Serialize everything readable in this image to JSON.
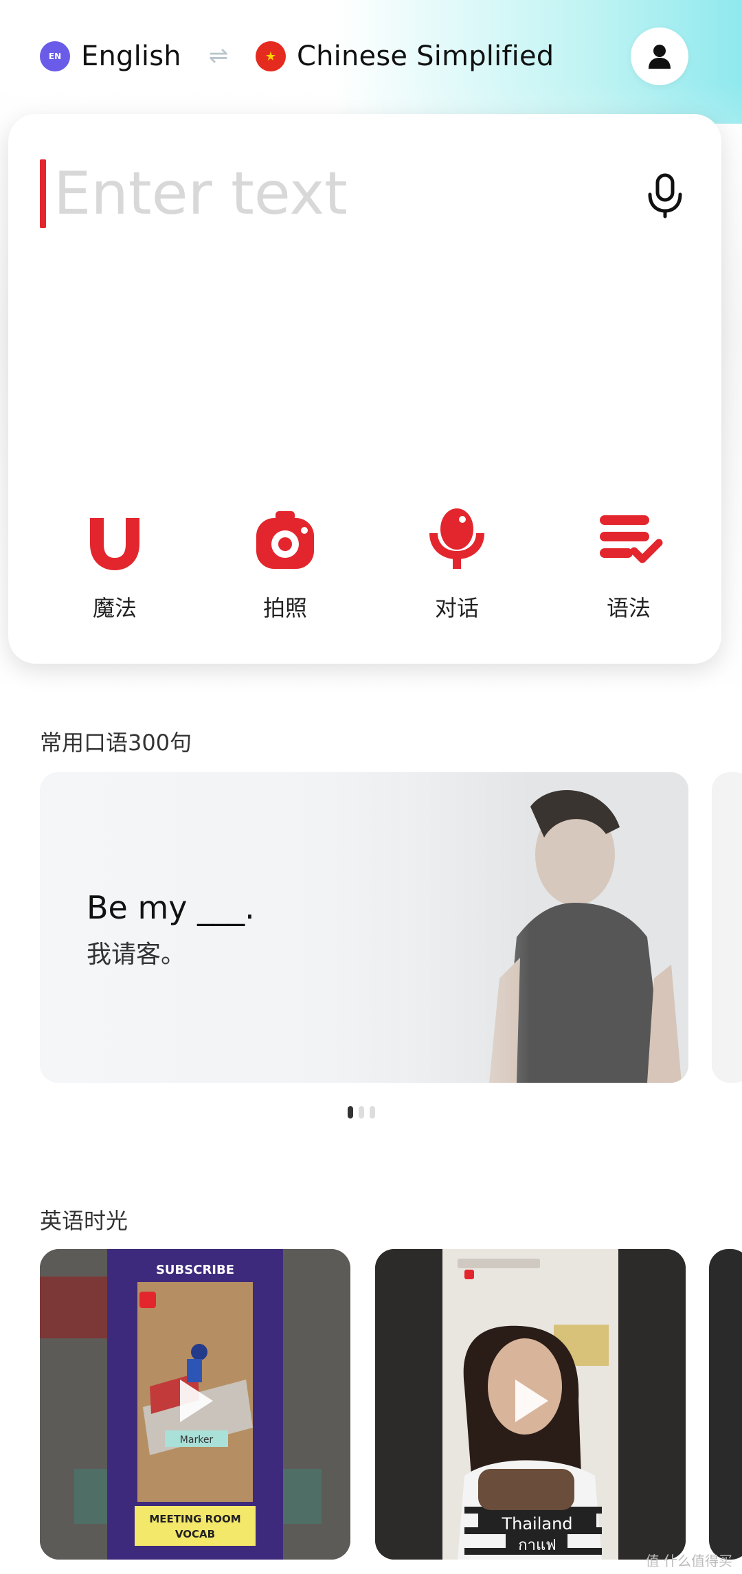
{
  "header": {
    "source_language": "English",
    "target_language": "Chinese Simplified",
    "source_flag_text": "EN",
    "swap_symbol": "⇌"
  },
  "translator": {
    "input_placeholder": "Enter text",
    "input_value": "",
    "tools": [
      {
        "label": "魔法",
        "icon": "magnet-icon"
      },
      {
        "label": "拍照",
        "icon": "camera-icon"
      },
      {
        "label": "对话",
        "icon": "microphone-icon"
      },
      {
        "label": "语法",
        "icon": "grammar-check-icon"
      }
    ]
  },
  "phrases_section": {
    "title": "常用口语300句",
    "card": {
      "english": "Be my ___.",
      "chinese": "我请客。"
    },
    "pagination": {
      "current": 1,
      "total": 3
    }
  },
  "videos_section": {
    "title": "英语时光",
    "videos": [
      {
        "overlay_top": "SUBSCRIBE",
        "tag": "Marker",
        "overlay_bottom_1": "MEETING ROOM",
        "overlay_bottom_2": "VOCAB"
      },
      {
        "caption_1": "Thailand",
        "caption_2": "กาแฟ"
      }
    ]
  },
  "watermark": "值 什么值得买",
  "colors": {
    "accent_red": "#e3262d",
    "header_gradient_end": "#8fe9ee",
    "text_primary": "#111111"
  }
}
